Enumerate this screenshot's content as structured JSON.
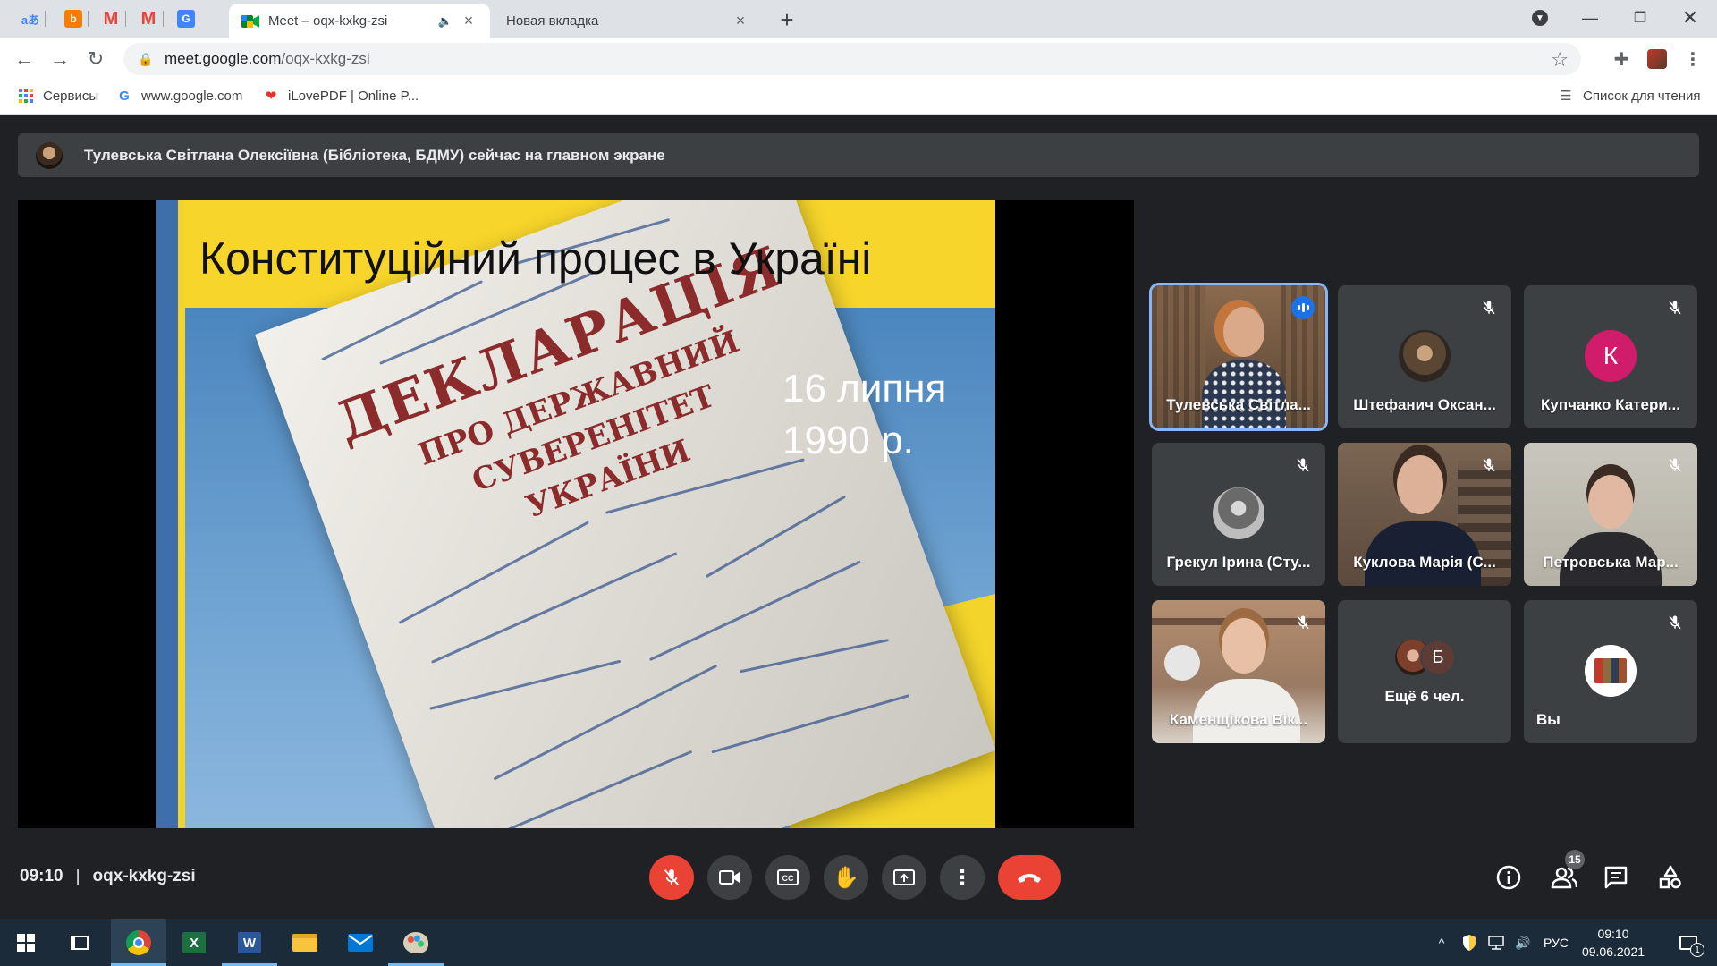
{
  "browser": {
    "pinned_tabs": [
      {
        "icon": "translate-icon",
        "color": "#4285f4",
        "glyph": "aあ"
      },
      {
        "icon": "blogger-icon",
        "color": "#f57d00",
        "glyph": "b"
      },
      {
        "icon": "gmail-icon",
        "color": "#ea4335",
        "glyph": "M"
      },
      {
        "icon": "gmail-icon",
        "color": "#ea4335",
        "glyph": "M"
      },
      {
        "icon": "google-translate-icon",
        "color": "#4285f4",
        "glyph": "G"
      }
    ],
    "tabs": [
      {
        "title": "Meet – oqx-kxkg-zsi",
        "active": true,
        "audio": "🔈"
      },
      {
        "title": "Новая вкладка",
        "active": false
      }
    ],
    "url_host": "meet.google.com",
    "url_path": "/oqx-kxkg-zsi",
    "bookmarks": [
      {
        "label": "Сервисы",
        "icon": "apps-grid-icon"
      },
      {
        "label": "www.google.com",
        "icon": "google-icon"
      },
      {
        "label": "iLovePDF | Online P...",
        "icon": "ilovepdf-icon"
      }
    ],
    "reading_list": "Список для чтения"
  },
  "meet": {
    "banner": "Тулевська Світлана Олексіївна (Бібліотека, БДМУ) сейчас на главном экране",
    "slide": {
      "title": "Конституційний процес в Україні",
      "date_line1": "16 липня",
      "date_line2": "1990 р.",
      "doc_line1": "ДЕКЛАРАЦІЯ",
      "doc_line2": "ПРО ДЕРЖАВНИЙ",
      "doc_line3": "СУВЕРЕНІТЕТ",
      "doc_line4": "УКРАЇНИ"
    },
    "participants": [
      {
        "name": "Тулевська Світла...",
        "state": "speaking",
        "kind": "video"
      },
      {
        "name": "Штефанич Оксан...",
        "state": "muted",
        "kind": "photo"
      },
      {
        "name": "Купчанко Катери...",
        "state": "muted",
        "kind": "letter",
        "letter": "К",
        "color": "#d01c6b"
      },
      {
        "name": "Грекул Ірина (Сту...",
        "state": "muted",
        "kind": "photo"
      },
      {
        "name": "Куклова Марія (С...",
        "state": "muted",
        "kind": "video"
      },
      {
        "name": "Петровська Мар...",
        "state": "muted",
        "kind": "video"
      },
      {
        "name": "Каменщікова Вік...",
        "state": "muted",
        "kind": "video"
      },
      {
        "name": "Ещё 6 чел.",
        "state": "none",
        "kind": "more",
        "letter": "Б"
      },
      {
        "name": "Вы",
        "state": "muted",
        "kind": "self"
      }
    ],
    "time": "09:10",
    "meeting_code": "oqx-kxkg-zsi",
    "people_count": "15"
  },
  "taskbar": {
    "language": "РУС",
    "clock_time": "09:10",
    "clock_date": "09.06.2021",
    "notification_count": "1"
  },
  "colors": {
    "meet_bg": "#202124",
    "tile_bg": "#3c4043",
    "red": "#ea4335",
    "speaking_blue": "#1a73e8"
  }
}
